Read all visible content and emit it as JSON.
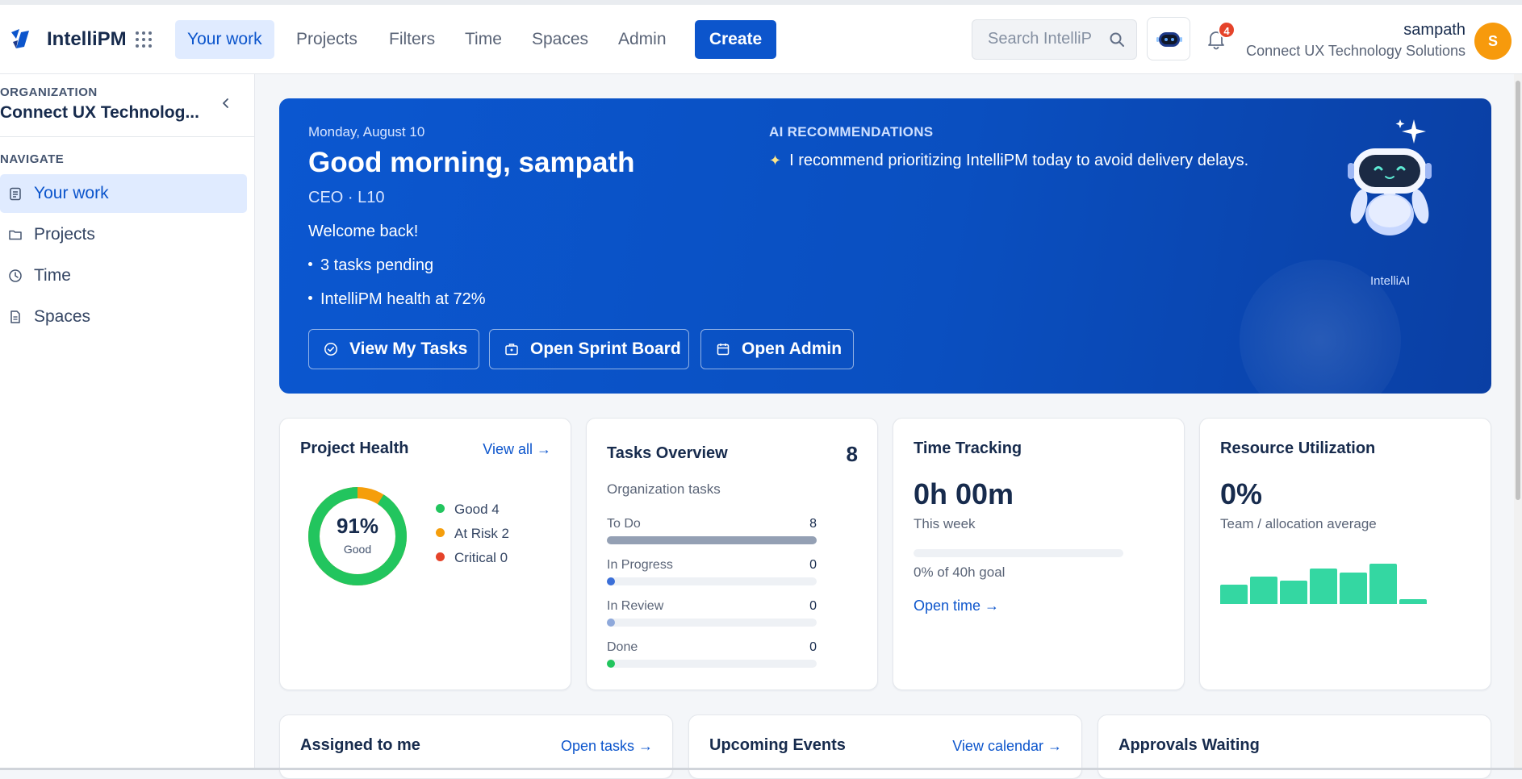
{
  "header": {
    "brand": "IntelliPM",
    "nav": [
      "Your work",
      "Projects",
      "Filters",
      "Time",
      "Spaces",
      "Admin"
    ],
    "active_nav": "Your work",
    "create_label": "Create",
    "search_placeholder": "Search IntelliP",
    "notifications_count": "4",
    "user_name": "sampath",
    "user_org": "Connect UX Technology Solutions",
    "avatar_initial": "S"
  },
  "sidebar": {
    "org_label": "ORGANIZATION",
    "org_name": "Connect UX Technolog...",
    "nav_label": "NAVIGATE",
    "items": [
      {
        "label": "Your work",
        "icon": "clipboard-icon",
        "active": true
      },
      {
        "label": "Projects",
        "icon": "folder-icon",
        "active": false
      },
      {
        "label": "Time",
        "icon": "clock-icon",
        "active": false
      },
      {
        "label": "Spaces",
        "icon": "document-icon",
        "active": false
      }
    ]
  },
  "hero": {
    "date": "Monday, August 10",
    "greeting": "Good morning, sampath",
    "role": "CEO · L10",
    "welcome": "Welcome back!",
    "bullets": [
      "3 tasks pending",
      "IntelliPM health at 72%"
    ],
    "ai_title": "AI RECOMMENDATIONS",
    "ai_recommendation": "I recommend prioritizing IntelliPM today to avoid delivery delays.",
    "buttons": [
      "View My Tasks",
      "Open Sprint Board",
      "Open Admin"
    ],
    "bot_label": "IntelliAI"
  },
  "project_health": {
    "title": "Project Health",
    "link": "View all →",
    "percent": "91%",
    "percent_label": "Good",
    "good_fraction": 0.91,
    "legend": [
      "Good 4",
      "At Risk 2",
      "Critical 0"
    ],
    "colors": {
      "good": "#22c55e",
      "at_risk": "#f59e0b",
      "critical": "#e5432a"
    }
  },
  "tasks_overview": {
    "title": "Tasks Overview",
    "total": "8",
    "subtitle": "Organization tasks",
    "statuses": [
      {
        "name": "To Do",
        "value": "8",
        "fraction": 1.0,
        "color": "#94a0b4"
      },
      {
        "name": "In Progress",
        "value": "0",
        "fraction": 0,
        "color": "#3b6fd8"
      },
      {
        "name": "In Review",
        "value": "0",
        "fraction": 0,
        "color": "#8fa9db"
      },
      {
        "name": "Done",
        "value": "0",
        "fraction": 0,
        "color": "#22c55e"
      }
    ]
  },
  "time_tracking": {
    "title": "Time Tracking",
    "value": "0h 00m",
    "period": "This week",
    "goal_text": "0% of 40h goal",
    "goal_fraction": 0,
    "link": "Open time →"
  },
  "resource_utilization": {
    "title": "Resource Utilization",
    "value": "0%",
    "subtitle": "Team / allocation average",
    "bar_levels": [
      0.48,
      0.68,
      0.58,
      0.88,
      0.78,
      1.0,
      0.12
    ],
    "bar_color": "#34d7a2"
  },
  "bottom_cards": [
    {
      "title": "Assigned to me",
      "link": "Open tasks →"
    },
    {
      "title": "Upcoming Events",
      "link": "View calendar →"
    },
    {
      "title": "Approvals Waiting",
      "link": ""
    }
  ]
}
